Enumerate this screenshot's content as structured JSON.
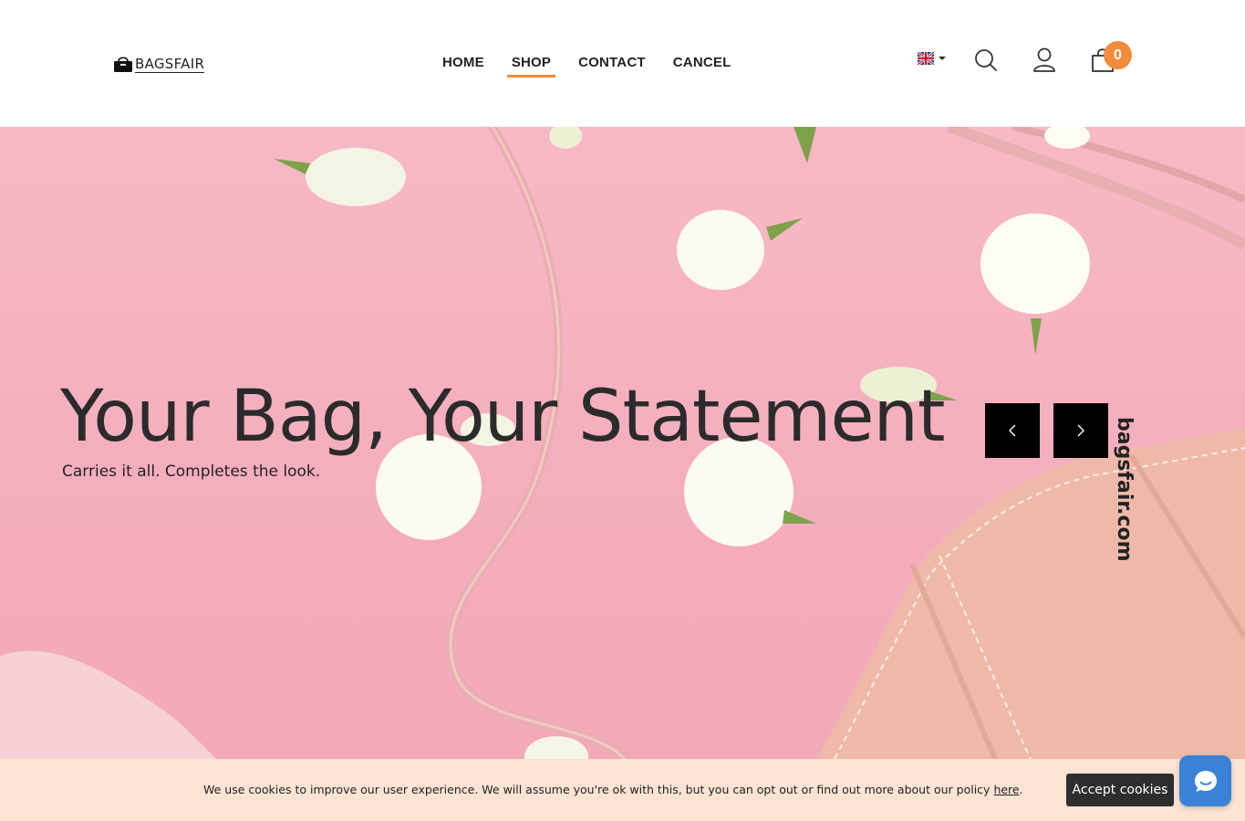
{
  "brand": {
    "logo_text": "BAGSFAIR"
  },
  "nav": {
    "items": [
      {
        "label": "HOME"
      },
      {
        "label": "SHOP"
      },
      {
        "label": "CONTACT"
      },
      {
        "label": "CANCEL"
      }
    ],
    "active": "SHOP"
  },
  "tools": {
    "language": "en-gb-flag",
    "search_icon": "search-icon",
    "account_icon": "user-icon",
    "cart_icon": "shopping-bag-icon",
    "cart_count": "0"
  },
  "hero": {
    "title": "Your Bag, Your Statement",
    "subtitle": "Carries it all. Completes the look.",
    "side_text": "bagsfair.com",
    "prev_icon": "chevron-left-icon",
    "next_icon": "chevron-right-icon"
  },
  "cookie": {
    "text": "We use cookies to improve our user experience. We will assume you're ok with this, but you can opt out or find out more about our policy ",
    "link_text": "here",
    "after_link": ".",
    "button_label": "Accept cookies"
  },
  "colors": {
    "accent": "#f08c3a",
    "hero_bg": "#f4adbd",
    "cookie_bg": "#fde3d4",
    "chat_button": "#3b82d6"
  }
}
